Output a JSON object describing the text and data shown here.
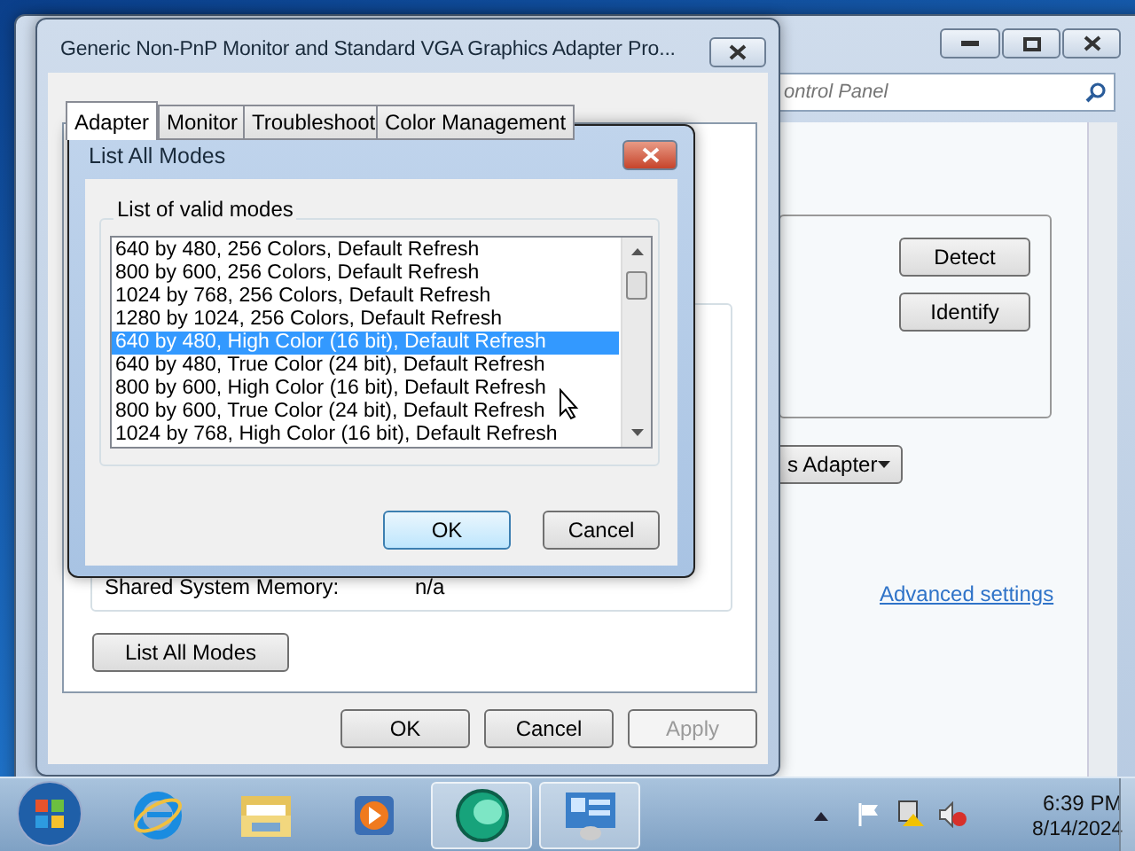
{
  "control_panel": {
    "search": {
      "placeholder": "ontrol Panel"
    },
    "buttons": [
      "Detect",
      "Identify"
    ],
    "dropdown": {
      "value": "s Adapter"
    },
    "link": "Advanced settings"
  },
  "properties": {
    "title": "Generic Non-PnP Monitor and Standard VGA Graphics Adapter Pro...",
    "tabs": [
      {
        "label": "Adapter",
        "selected": true
      },
      {
        "label": "Monitor",
        "selected": false
      },
      {
        "label": "Troubleshoot",
        "selected": false
      },
      {
        "label": "Color Management",
        "selected": false
      }
    ],
    "info": {
      "label": "Shared System Memory:",
      "value": "n/a"
    },
    "list_button": "List All Modes",
    "buttons": [
      {
        "label": "OK",
        "disabled": false
      },
      {
        "label": "Cancel",
        "disabled": false
      },
      {
        "label": "Apply",
        "disabled": true
      }
    ]
  },
  "modes_dialog": {
    "title": "List All Modes",
    "group": "List of valid modes",
    "modes": [
      {
        "label": "640 by 480, 256 Colors, Default Refresh",
        "selected": false
      },
      {
        "label": "800 by 600, 256 Colors, Default Refresh",
        "selected": false
      },
      {
        "label": "1024 by 768, 256 Colors, Default Refresh",
        "selected": false
      },
      {
        "label": "1280 by 1024, 256 Colors, Default Refresh",
        "selected": false
      },
      {
        "label": "640 by 480, High Color (16 bit), Default Refresh",
        "selected": true
      },
      {
        "label": "640 by 480, True Color (24 bit), Default Refresh",
        "selected": false
      },
      {
        "label": "800 by 600, High Color (16 bit), Default Refresh",
        "selected": false
      },
      {
        "label": "800 by 600, True Color (24 bit), Default Refresh",
        "selected": false
      },
      {
        "label": "1024 by 768, High Color (16 bit), Default Refresh",
        "selected": false
      }
    ],
    "buttons": [
      {
        "label": "OK",
        "default": true
      },
      {
        "label": "Cancel",
        "default": false
      }
    ]
  },
  "taskbar": {
    "apps": [
      {
        "kind": "ie",
        "active": false
      },
      {
        "kind": "folder",
        "active": false
      },
      {
        "kind": "media",
        "active": false
      },
      {
        "kind": "disc",
        "active": true
      },
      {
        "kind": "panel",
        "active": true
      }
    ],
    "time": "6:39 PM",
    "date": "8/14/2024"
  }
}
